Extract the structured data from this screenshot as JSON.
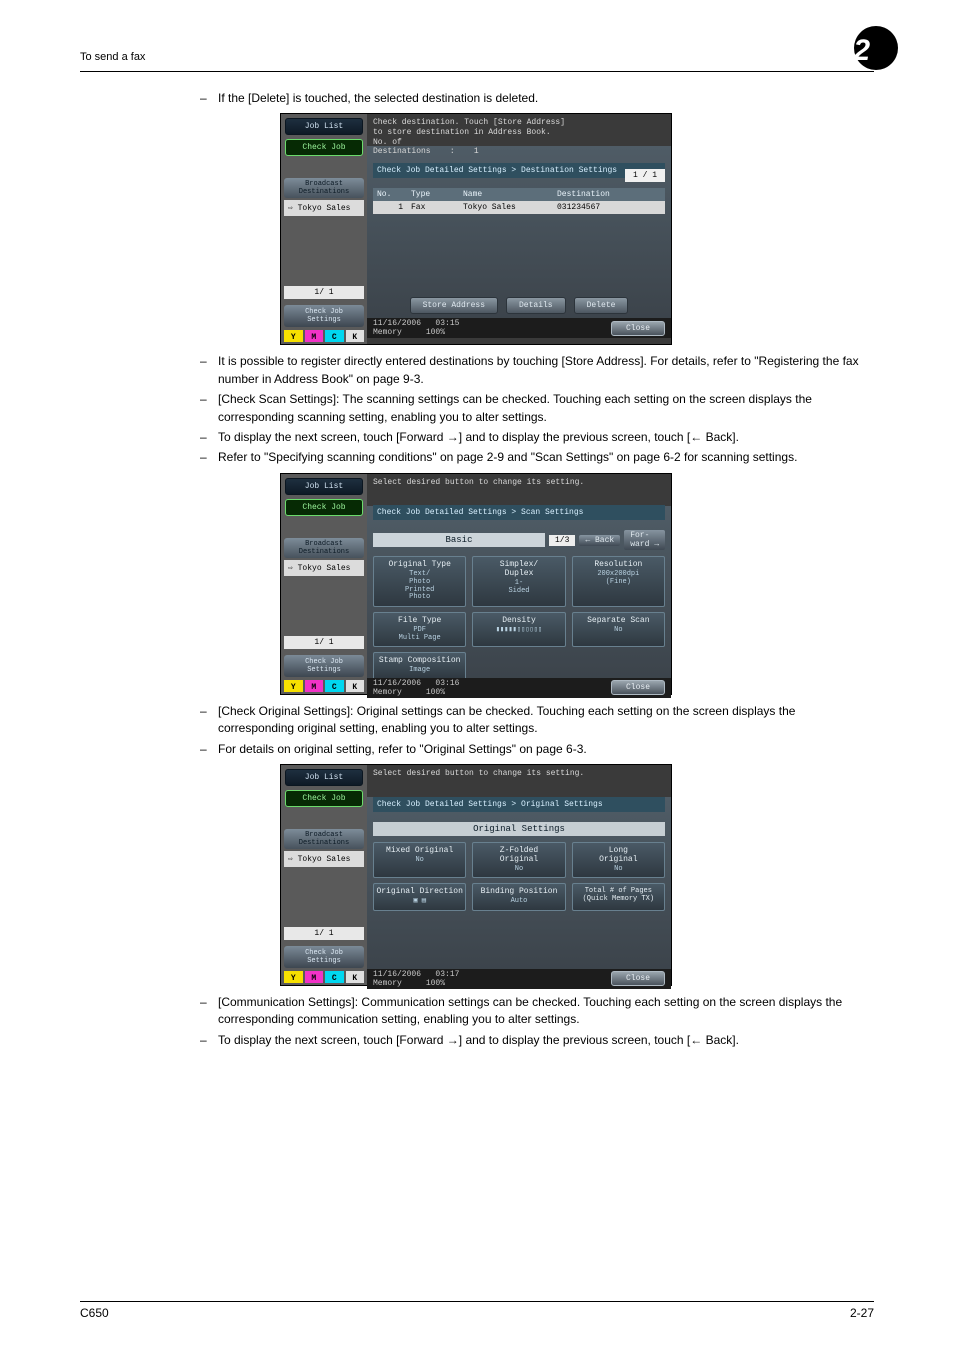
{
  "header": {
    "left": "To send a fax",
    "chapter": "2"
  },
  "body": {
    "p1": "If the [Delete] is touched, the selected destination is deleted.",
    "p2": "It is possible to register directly entered destinations by touching [Store Address]. For details, refer to \"Registering the fax number in Address Book\" on page 9-3.",
    "p3": "[Check Scan Settings]: The scanning settings can be checked. Touching each setting on the screen displays the corresponding scanning setting, enabling you to alter settings.",
    "p4": "To display the next screen, touch [Forward →] and to display the previous screen, touch [← Back].",
    "p5": "Refer to \"Specifying scanning conditions\" on page 2-9 and \"Scan Settings\" on page 6-2 for scanning settings.",
    "p6": "[Check Original Settings]: Original settings can be checked. Touching each setting on the screen displays the corresponding original setting, enabling you to alter settings.",
    "p7": "For details on original setting, refer to \"Original Settings\" on page 6-3.",
    "p8": "[Communication Settings]: Communication settings can be checked. Touching each setting on the screen displays the corresponding communication setting, enabling you to alter settings.",
    "p9": "To display the next screen, touch [Forward →] and to display the previous screen, touch [← Back]."
  },
  "sidebar": {
    "jobList": "Job List",
    "checkJob": "Check Job",
    "broadcast": "Broadcast\nDestinations",
    "destItem": "⇨ Tokyo Sales",
    "pager": "1/  1",
    "checkJobSettings": "Check Job\nSettings",
    "toners": [
      "Y",
      "M",
      "C",
      "K"
    ]
  },
  "shot1": {
    "msg1": "Check destination. Touch [Store Address]",
    "msg2": "to store destination in Address Book.",
    "msg3": "No. of\nDestinations    :    1",
    "crumb": "Check Job Detailed Settings > Destination Settings",
    "cols": {
      "no": "No.",
      "type": "Type",
      "name": "Name",
      "dest": "Destination"
    },
    "row": {
      "no": "1",
      "type": "Fax",
      "name": "Tokyo Sales",
      "dest": "031234567"
    },
    "pageCount": "1 / 1",
    "buttons": {
      "store": "Store Address",
      "details": "Details",
      "delete": "Delete"
    },
    "status": {
      "date": "11/16/2006",
      "time": "03:15",
      "memLabel": "Memory",
      "mem": "100%",
      "close": "Close"
    }
  },
  "shot2": {
    "msg": "Select desired button to change its setting.",
    "crumb": "Check Job Detailed Settings > Scan Settings",
    "tab": "Basic",
    "page": "1/3",
    "back": "Back",
    "forward": "For-\nward",
    "tiles": [
      {
        "title": "Original Type",
        "sub": "Text/\nPhoto\nPrinted\nPhoto"
      },
      {
        "title": "Simplex/\nDuplex",
        "sub": "1-\nSided"
      },
      {
        "title": "Resolution",
        "sub": "200x200dpi\n(Fine)"
      },
      {
        "title": "File Type",
        "sub": "PDF\nMulti Page"
      },
      {
        "title": "Density",
        "sub": "▮▮▮▮▮▯▯▯▯▯▯"
      },
      {
        "title": "Separate Scan",
        "sub": "No"
      },
      {
        "title": "Stamp Composition",
        "sub": "Image"
      }
    ],
    "status": {
      "date": "11/16/2006",
      "time": "03:16",
      "memLabel": "Memory",
      "mem": "100%",
      "close": "Close"
    }
  },
  "shot3": {
    "msg": "Select desired button to change its setting.",
    "crumb": "Check Job Detailed Settings > Original Settings",
    "tab": "Original Settings",
    "tiles": [
      {
        "title": "Mixed Original",
        "sub": "No"
      },
      {
        "title": "Z-Folded\nOriginal",
        "sub": "No"
      },
      {
        "title": "Long\nOriginal",
        "sub": "No"
      },
      {
        "title": "Original Direction",
        "sub": "▣ ▤"
      },
      {
        "title": "Binding Position",
        "sub": "Auto"
      },
      {
        "title": "Total # of Pages\n(Quick Memory TX)",
        "sub": ""
      }
    ],
    "status": {
      "date": "11/16/2006",
      "time": "03:17",
      "memLabel": "Memory",
      "mem": "100%",
      "close": "Close"
    }
  },
  "footer": {
    "left": "C650",
    "right": "2-27"
  }
}
